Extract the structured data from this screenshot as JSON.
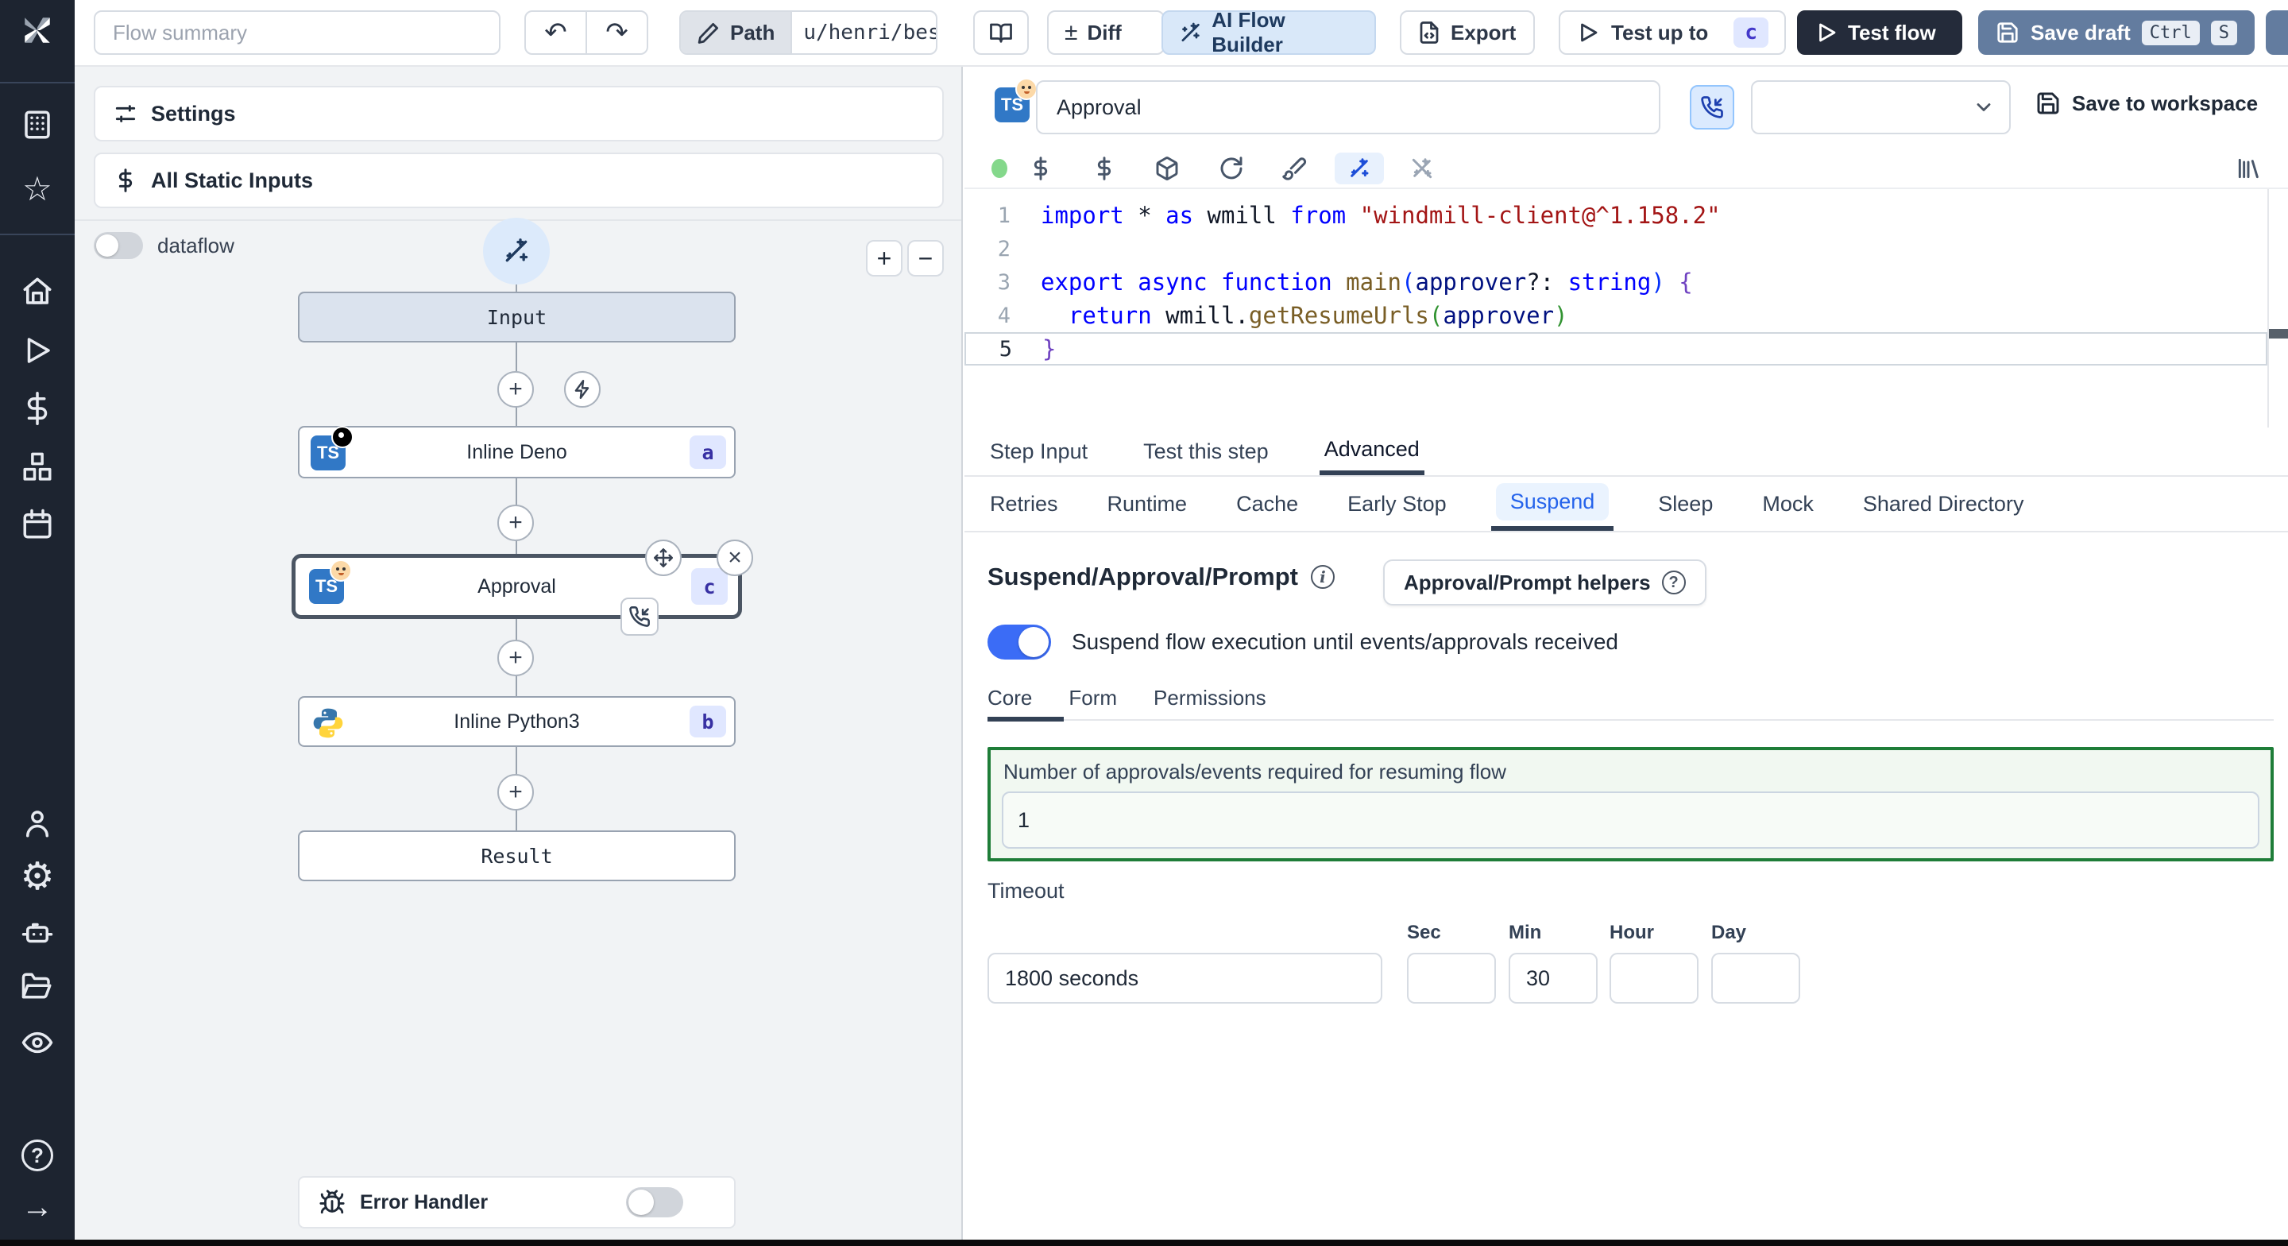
{
  "colors": {
    "accent_blue": "#3b6cf6",
    "dark_button": "#242b3a",
    "save_draft": "#637c9f",
    "badge_bg": "#e0e7ff",
    "badge_text": "#3730a3",
    "green_border": "#1e7d38",
    "ts_blue": "#3178c6",
    "sidebar_bg": "#1d2430"
  },
  "topbar": {
    "flow_summary_placeholder": "Flow summary",
    "path_label": "Path",
    "path_value": "u/henri/bes",
    "diff_label": "Diff",
    "diff_sign": "±",
    "ai_builder_label": "AI Flow Builder",
    "export_label": "Export",
    "test_up_to_label": "Test up to",
    "test_up_to_badge": "c",
    "test_flow_label": "Test flow",
    "save_draft_label": "Save draft",
    "kbd_ctrl": "Ctrl",
    "kbd_s": "S",
    "undo": "↶",
    "redo": "↷"
  },
  "sidebar": {
    "icons": [
      "windmill-logo",
      "workspace",
      "favorites",
      "home",
      "runs",
      "variables",
      "resources",
      "schedules",
      "users",
      "settings",
      "workers",
      "folders",
      "audit-logs",
      "help",
      "collapse"
    ]
  },
  "left": {
    "settings_label": "Settings",
    "static_inputs_label": "All Static Inputs",
    "dataflow_label": "dataflow",
    "zoom_in": "+",
    "zoom_out": "−",
    "error_handler_label": "Error Handler"
  },
  "graph": {
    "input_label": "Input",
    "deno_label": "Inline Deno",
    "deno_badge": "a",
    "approval_label": "Approval",
    "approval_badge": "c",
    "python_label": "Inline Python3",
    "python_badge": "b",
    "result_label": "Result",
    "ts_badge_text": "TS"
  },
  "right": {
    "name_value": "Approval",
    "save_to_workspace": "Save to workspace",
    "tabs": [
      "Step Input",
      "Test this step",
      "Advanced"
    ],
    "subtabs": [
      "Retries",
      "Runtime",
      "Cache",
      "Early Stop",
      "Suspend",
      "Sleep",
      "Mock",
      "Shared Directory"
    ],
    "suspend": {
      "heading": "Suspend/Approval/Prompt",
      "helpers_label": "Approval/Prompt helpers",
      "toggle_label": "Suspend flow execution until events/approvals received",
      "core_tabs": [
        "Core",
        "Form",
        "Permissions"
      ],
      "approvals_label": "Number of approvals/events required for resuming flow",
      "approvals_value": "1"
    },
    "timeout": {
      "label": "Timeout",
      "value": "1800 seconds",
      "units": [
        "Sec",
        "Min",
        "Hour",
        "Day"
      ],
      "min_value": "30",
      "sec_value": "",
      "hour_value": "",
      "day_value": ""
    }
  },
  "code": {
    "lines": [
      {
        "tokens": [
          {
            "c": "k",
            "t": "import"
          },
          {
            "c": "p",
            "t": " * "
          },
          {
            "c": "k",
            "t": "as"
          },
          {
            "c": "p",
            "t": " wmill "
          },
          {
            "c": "k",
            "t": "from"
          },
          {
            "c": "p",
            "t": " "
          },
          {
            "c": "s",
            "t": "\"windmill-client@^1.158.2\""
          }
        ]
      },
      {
        "tokens": []
      },
      {
        "tokens": [
          {
            "c": "k",
            "t": "export"
          },
          {
            "c": "p",
            "t": " "
          },
          {
            "c": "k",
            "t": "async"
          },
          {
            "c": "p",
            "t": " "
          },
          {
            "c": "k",
            "t": "function"
          },
          {
            "c": "p",
            "t": " "
          },
          {
            "c": "f",
            "t": "main"
          },
          {
            "c": "b1",
            "t": "("
          },
          {
            "c": "v",
            "t": "approver"
          },
          {
            "c": "p",
            "t": "?: "
          },
          {
            "c": "k",
            "t": "string"
          },
          {
            "c": "b1",
            "t": ")"
          },
          {
            "c": "p",
            "t": " "
          },
          {
            "c": "b3",
            "t": "{"
          }
        ]
      },
      {
        "tokens": [
          {
            "c": "p",
            "t": "  "
          },
          {
            "c": "k",
            "t": "return"
          },
          {
            "c": "p",
            "t": " wmill."
          },
          {
            "c": "f",
            "t": "getResumeUrls"
          },
          {
            "c": "b2",
            "t": "("
          },
          {
            "c": "v",
            "t": "approver"
          },
          {
            "c": "b2",
            "t": ")"
          }
        ]
      },
      {
        "tokens": [
          {
            "c": "b3",
            "t": "}"
          }
        ],
        "active": true
      }
    ]
  }
}
